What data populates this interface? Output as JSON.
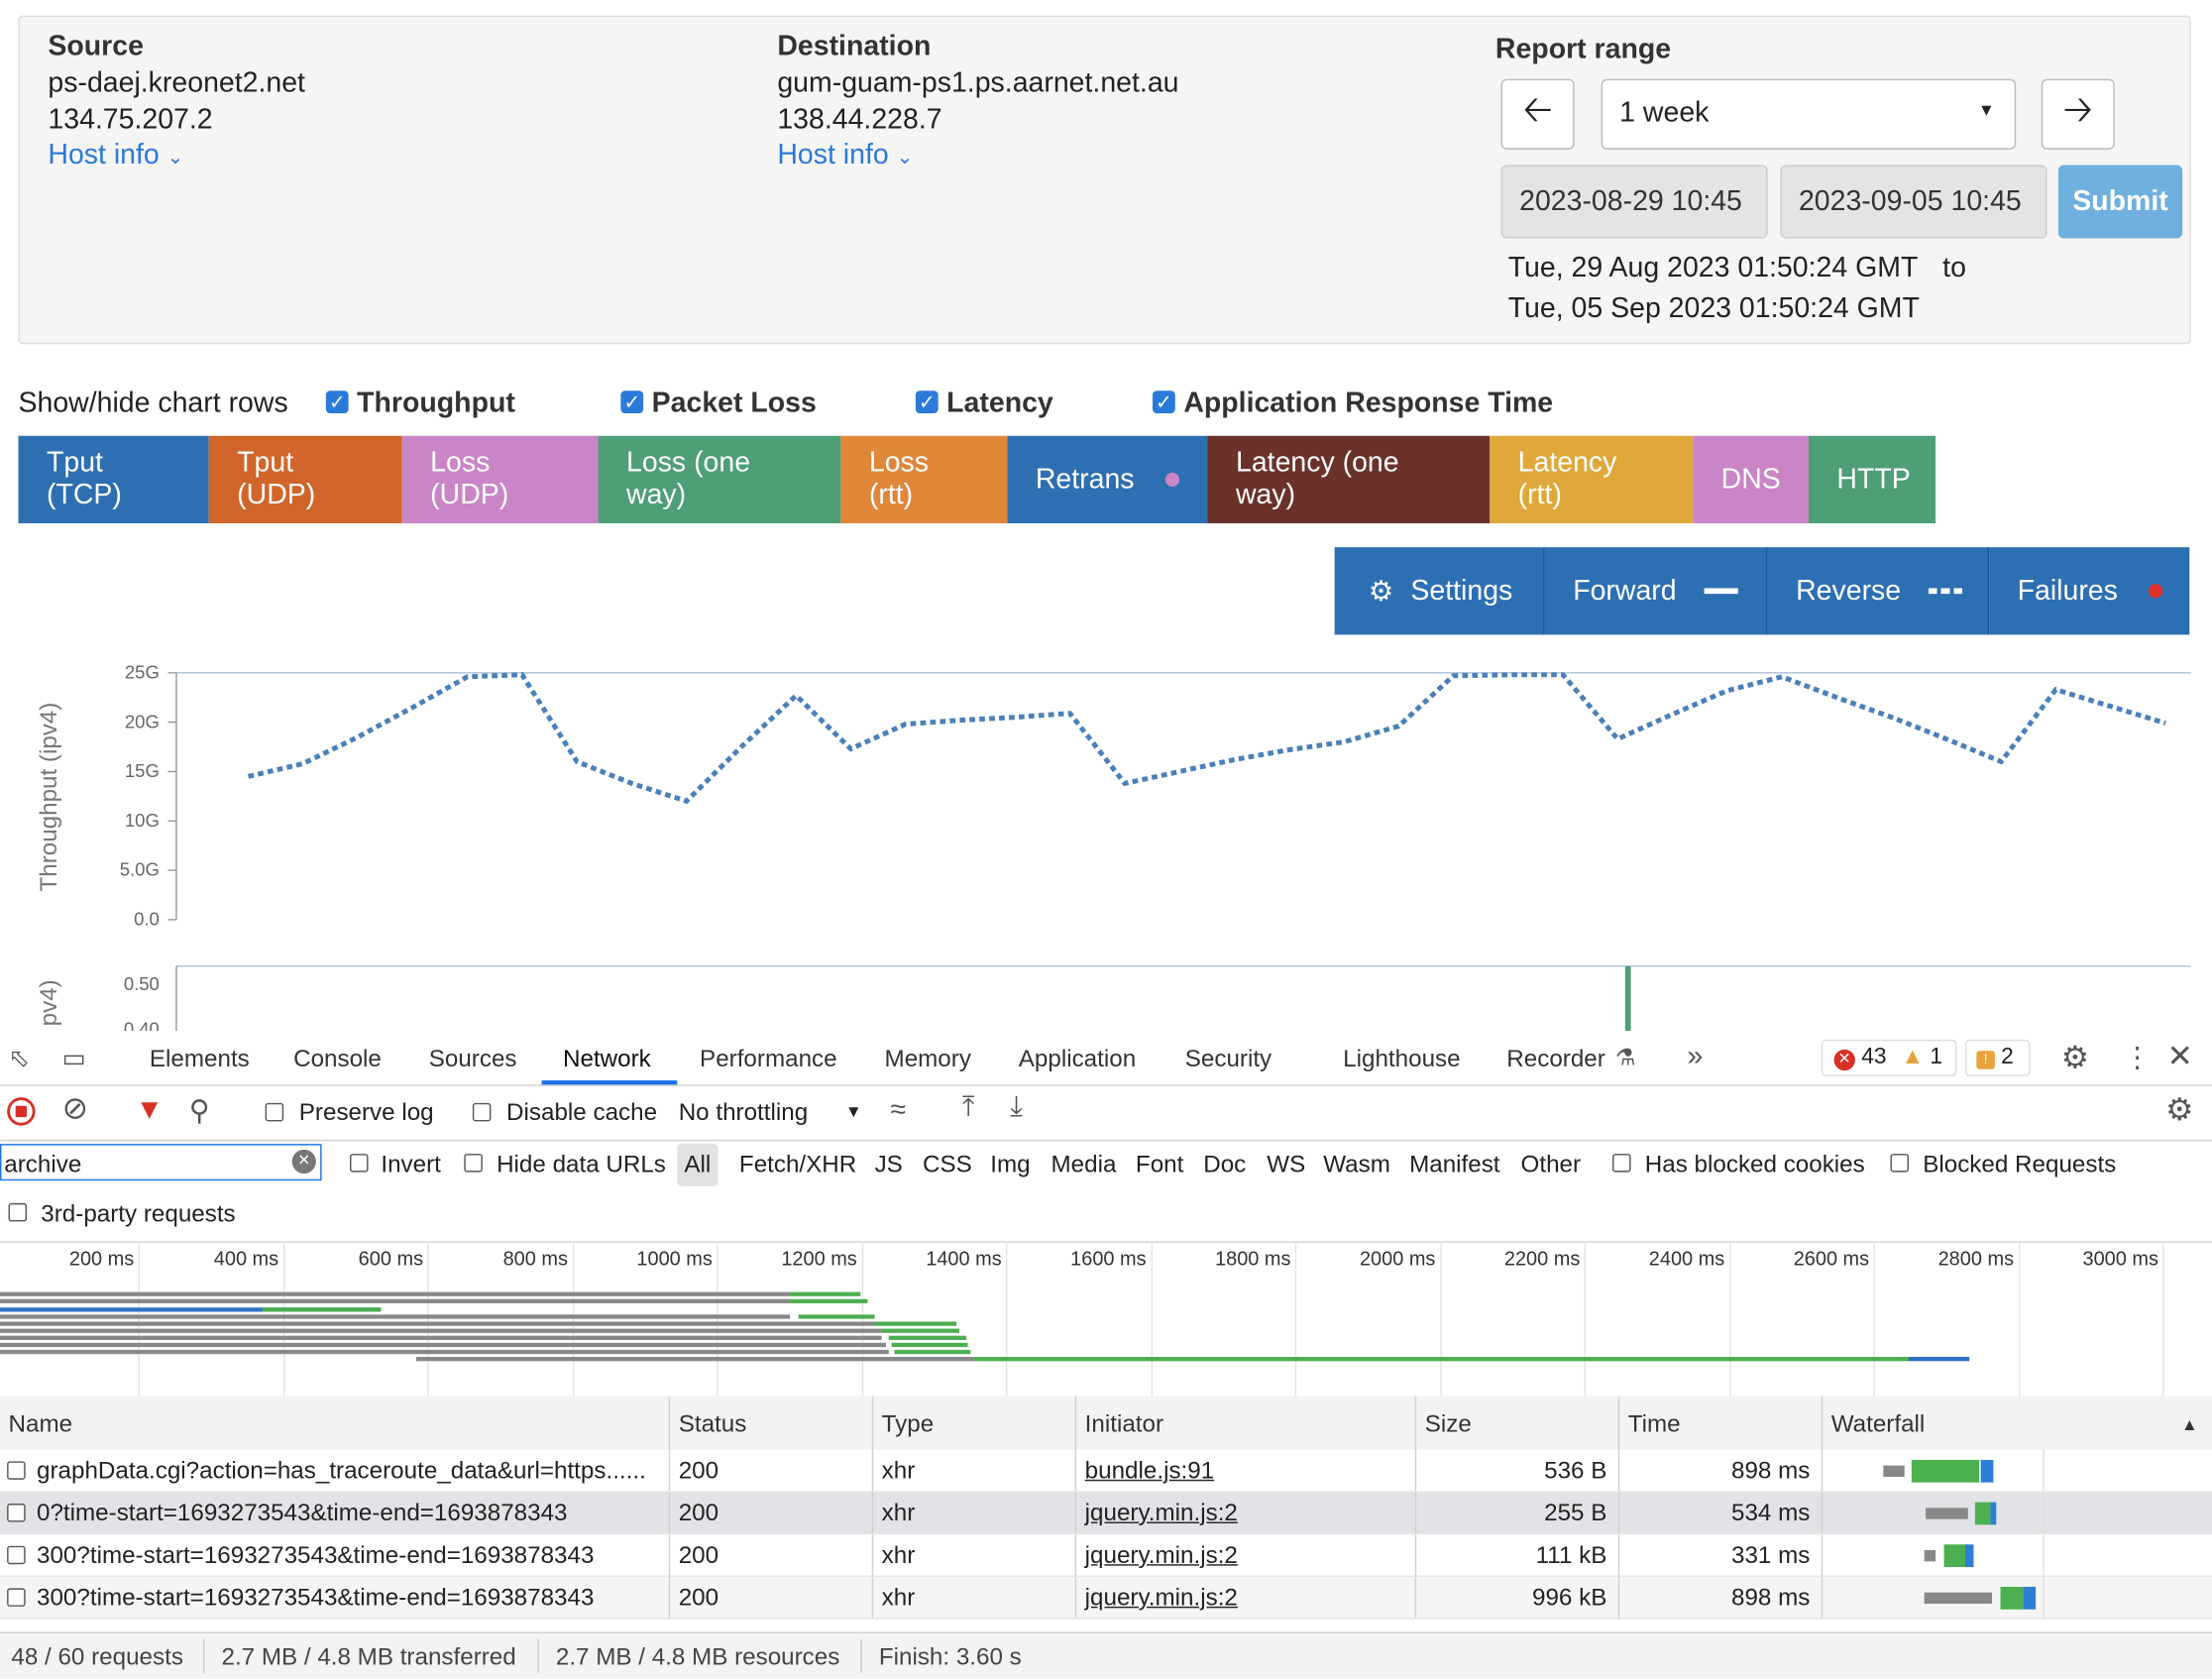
{
  "source": {
    "label": "Source",
    "host": "ps-daej.kreonet2.net",
    "ip": "134.75.207.2",
    "host_info": "Host info"
  },
  "destination": {
    "label": "Destination",
    "host": "gum-guam-ps1.ps.aarnet.net.au",
    "ip": "138.44.228.7",
    "host_info": "Host info"
  },
  "report_range": {
    "label": "Report range",
    "selected": "1 week",
    "start": "2023-08-29 10:45",
    "end": "2023-09-05 10:45",
    "submit": "Submit",
    "range_from": "Tue, 29 Aug 2023 01:50:24 GMT",
    "to": "to",
    "range_to": "Tue, 05 Sep 2023 01:50:24 GMT"
  },
  "rows_toggle": {
    "label": "Show/hide chart rows",
    "items": [
      {
        "label": "Throughput"
      },
      {
        "label": "Packet Loss"
      },
      {
        "label": "Latency"
      },
      {
        "label": "Application Response Time"
      }
    ]
  },
  "legend": [
    {
      "label": "Tput (TCP)",
      "color": "#2e6fb1"
    },
    {
      "label": "Tput (UDP)",
      "color": "#d1652a"
    },
    {
      "label": "Loss (UDP)",
      "color": "#c985c6"
    },
    {
      "label": "Loss (one way)",
      "color": "#4e9e77"
    },
    {
      "label": "Loss (rtt)",
      "color": "#e0873a"
    },
    {
      "label": "Retrans",
      "color": "#2e6fb1"
    },
    {
      "label": "Latency (one way)",
      "color": "#6b3229"
    },
    {
      "label": "Latency (rtt)",
      "color": "#e0a83a"
    },
    {
      "label": "DNS",
      "color": "#c985c6"
    },
    {
      "label": "HTTP",
      "color": "#4e9e77"
    }
  ],
  "settings_bar": {
    "settings": "Settings",
    "forward": "Forward",
    "reverse": "Reverse",
    "failures": "Failures"
  },
  "chart_data": [
    {
      "type": "line",
      "ylabel": "Throughput (ipv4)",
      "yticks": [
        "0.0",
        "5.0G",
        "10G",
        "15G",
        "20G",
        "25G"
      ],
      "ylim": [
        0,
        25
      ],
      "series": [
        {
          "color": "#4a80b8",
          "style": "dotted",
          "values": [
            14.5,
            15.8,
            18.5,
            21.5,
            24.6,
            24.8,
            16.0,
            13.8,
            12.0,
            17.5,
            22.7,
            17.3,
            19.8,
            20.2,
            20.5,
            20.9,
            13.8,
            15.0,
            16.2,
            17.2,
            18.0,
            19.6,
            24.7,
            24.8,
            24.8,
            18.3,
            20.8,
            23.2,
            24.6,
            22.5,
            20.5,
            18.3,
            16.0,
            23.3,
            21.6,
            19.9
          ]
        }
      ]
    },
    {
      "type": "bar",
      "ylabel": "pv4)",
      "yticks": [
        "0.40",
        "0.50"
      ],
      "values": [
        0.6
      ],
      "color": "#4e9e77"
    }
  ],
  "devtools": {
    "tabs": [
      "Elements",
      "Console",
      "Sources",
      "Network",
      "Performance",
      "Memory",
      "Application",
      "Security",
      "Lighthouse",
      "Recorder"
    ],
    "active_tab": "Network",
    "errors": "43",
    "warnings": "1",
    "issues": "2",
    "preserve_log": "Preserve log",
    "disable_cache": "Disable cache",
    "throttling": "No throttling",
    "filter_value": "archive",
    "invert": "Invert",
    "hide_data_urls": "Hide data URLs",
    "type_filters": [
      "All",
      "Fetch/XHR",
      "JS",
      "CSS",
      "Img",
      "Media",
      "Font",
      "Doc",
      "WS",
      "Wasm",
      "Manifest",
      "Other"
    ],
    "has_blocked_cookies": "Has blocked cookies",
    "blocked_requests": "Blocked Requests",
    "third_party": "3rd-party requests",
    "ticks": [
      "200 ms",
      "400 ms",
      "600 ms",
      "800 ms",
      "1000 ms",
      "1200 ms",
      "1400 ms",
      "1600 ms",
      "1800 ms",
      "2000 ms",
      "2200 ms",
      "2400 ms",
      "2600 ms",
      "2800 ms",
      "3000 ms"
    ],
    "columns": [
      "Name",
      "Status",
      "Type",
      "Initiator",
      "Size",
      "Time",
      "Waterfall"
    ],
    "rows": [
      {
        "name": "graphData.cgi?action=has_traceroute_data&url=https......",
        "status": "200",
        "type": "xhr",
        "initiator": "bundle.js:91",
        "size": "536 B",
        "time": "898 ms"
      },
      {
        "name": "0?time-start=1693273543&time-end=1693878343",
        "status": "200",
        "type": "xhr",
        "initiator": "jquery.min.js:2",
        "size": "255 B",
        "time": "534 ms"
      },
      {
        "name": "300?time-start=1693273543&time-end=1693878343",
        "status": "200",
        "type": "xhr",
        "initiator": "jquery.min.js:2",
        "size": "111 kB",
        "time": "331 ms"
      },
      {
        "name": "300?time-start=1693273543&time-end=1693878343",
        "status": "200",
        "type": "xhr",
        "initiator": "jquery.min.js:2",
        "size": "996 kB",
        "time": "898 ms"
      }
    ],
    "status": {
      "requests": "48 / 60 requests",
      "transferred": "2.7 MB / 4.8 MB transferred",
      "resources": "2.7 MB / 4.8 MB resources",
      "finish": "Finish: 3.60 s"
    }
  }
}
